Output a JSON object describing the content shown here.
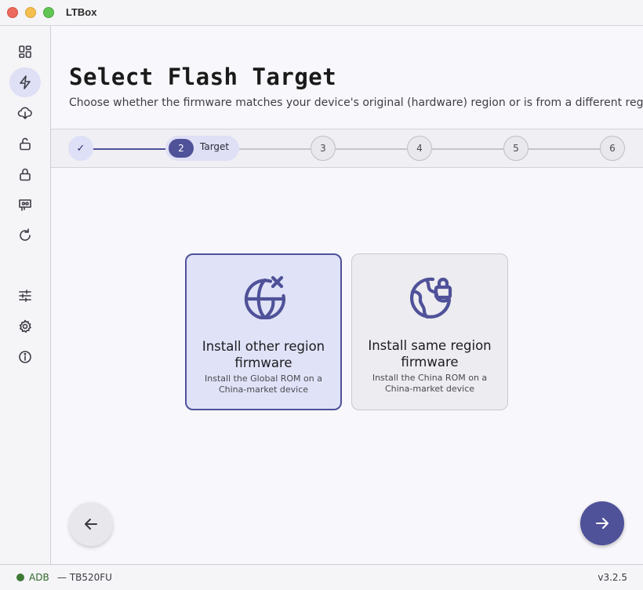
{
  "window": {
    "title": "LTBox"
  },
  "sidebar": {
    "items": [
      {
        "icon": "dashboard-icon"
      },
      {
        "icon": "flash-icon",
        "active": true
      },
      {
        "icon": "cloud-download-icon"
      },
      {
        "icon": "unlock-icon"
      },
      {
        "icon": "lock-icon"
      },
      {
        "icon": "device-icon"
      },
      {
        "icon": "refresh-icon"
      },
      {
        "icon": "sliders-icon"
      },
      {
        "icon": "gear-icon"
      },
      {
        "icon": "info-icon"
      }
    ]
  },
  "page": {
    "title": "Select Flash Target",
    "subtitle": "Choose whether the firmware matches your device's original (hardware) region or is from a different region."
  },
  "stepper": {
    "done_mark": "✓",
    "active_number": "2",
    "active_label": "Target",
    "steps": [
      "3",
      "4",
      "5",
      "6"
    ]
  },
  "options": [
    {
      "icon": "globe-x-icon",
      "title": "Install other region firmware",
      "description": "Install the Global ROM on a China-market device",
      "selected": true
    },
    {
      "icon": "globe-lock-icon",
      "title": "Install same region firmware",
      "description": "Install the China ROM on a China-market device",
      "selected": false
    }
  ],
  "status": {
    "connection": "ADB",
    "device": "— TB520FU",
    "version": "v3.2.5"
  },
  "colors": {
    "accent": "#4f5199",
    "connected": "#3e7a36"
  }
}
